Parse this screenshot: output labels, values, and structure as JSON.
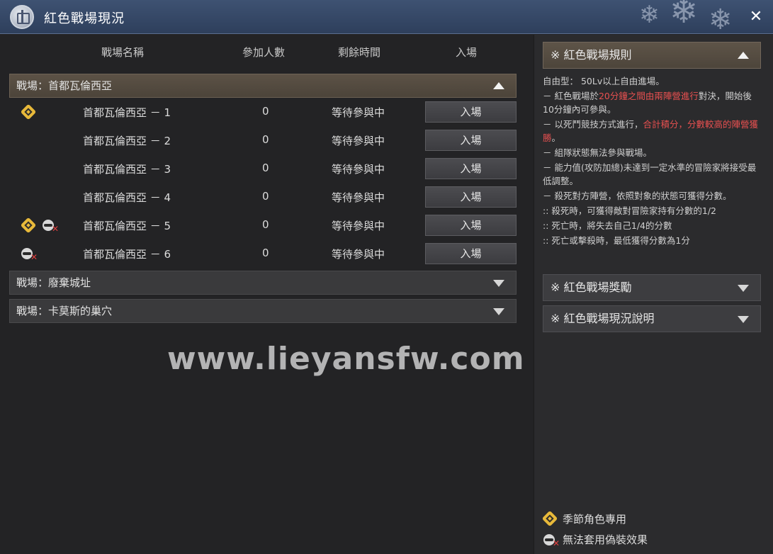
{
  "window": {
    "title": "紅色戰場現況",
    "close_icon": "collapse-arrows-icon"
  },
  "columns": {
    "name": "戰場名稱",
    "participants": "參加人數",
    "remaining_time": "剩餘時間",
    "enter": "入場"
  },
  "sections": [
    {
      "label": "戰場：首都瓦倫西亞",
      "expanded": true,
      "rows": [
        {
          "name": "首都瓦倫西亞 － 1",
          "count": "0",
          "status": "等待參與中",
          "button": "入場",
          "season_only": true,
          "no_disguise": false
        },
        {
          "name": "首都瓦倫西亞 － 2",
          "count": "0",
          "status": "等待參與中",
          "button": "入場",
          "season_only": false,
          "no_disguise": false
        },
        {
          "name": "首都瓦倫西亞 － 3",
          "count": "0",
          "status": "等待參與中",
          "button": "入場",
          "season_only": false,
          "no_disguise": false
        },
        {
          "name": "首都瓦倫西亞 － 4",
          "count": "0",
          "status": "等待參與中",
          "button": "入場",
          "season_only": false,
          "no_disguise": false
        },
        {
          "name": "首都瓦倫西亞 － 5",
          "count": "0",
          "status": "等待參與中",
          "button": "入場",
          "season_only": true,
          "no_disguise": true
        },
        {
          "name": "首都瓦倫西亞 － 6",
          "count": "0",
          "status": "等待參與中",
          "button": "入場",
          "season_only": false,
          "no_disguise": true
        }
      ]
    },
    {
      "label": "戰場：廢棄城址",
      "expanded": false
    },
    {
      "label": "戰場：卡莫斯的巢穴",
      "expanded": false
    }
  ],
  "watermark": "www.lieyansfw.com",
  "right_panel": {
    "rules_header": "※ 紅色戰場規則",
    "rules": {
      "line1": "自由型： 50Lv以上自由進場。",
      "line2_a": "－ 紅色戰場於",
      "line2_red": "20分鐘之間由兩陣營進行",
      "line2_b": "對決，開始後10分鐘內可參與。",
      "line3_a": "－ 以死鬥競技方式進行，",
      "line3_red": "合計積分，分數較高的陣營獲勝",
      "line3_b": "。",
      "line4": "－ 組隊狀態無法參與戰場。",
      "line5": "－ 能力值(攻防加總)未達到一定水準的冒險家將接受最低調整。",
      "line6": "－ 殺死對方陣營，依照對象的狀態可獲得分數。",
      "line7": ":: 殺死時，可獲得敵對冒險家持有分數的1/2",
      "line8": ":: 死亡時，將失去自己1/4的分數",
      "line9": ":: 死亡或擊殺時，最低獲得分數為1分"
    },
    "rewards_header": "※ 紅色戰場獎勵",
    "status_header": "※ 紅色戰場現況說明",
    "legend": {
      "season_only": "季節角色專用",
      "no_disguise": "無法套用偽裝效果"
    }
  },
  "colors": {
    "accent_red": "#e85050",
    "season_gold": "#e8b93a",
    "titlebar": "#34486a"
  }
}
